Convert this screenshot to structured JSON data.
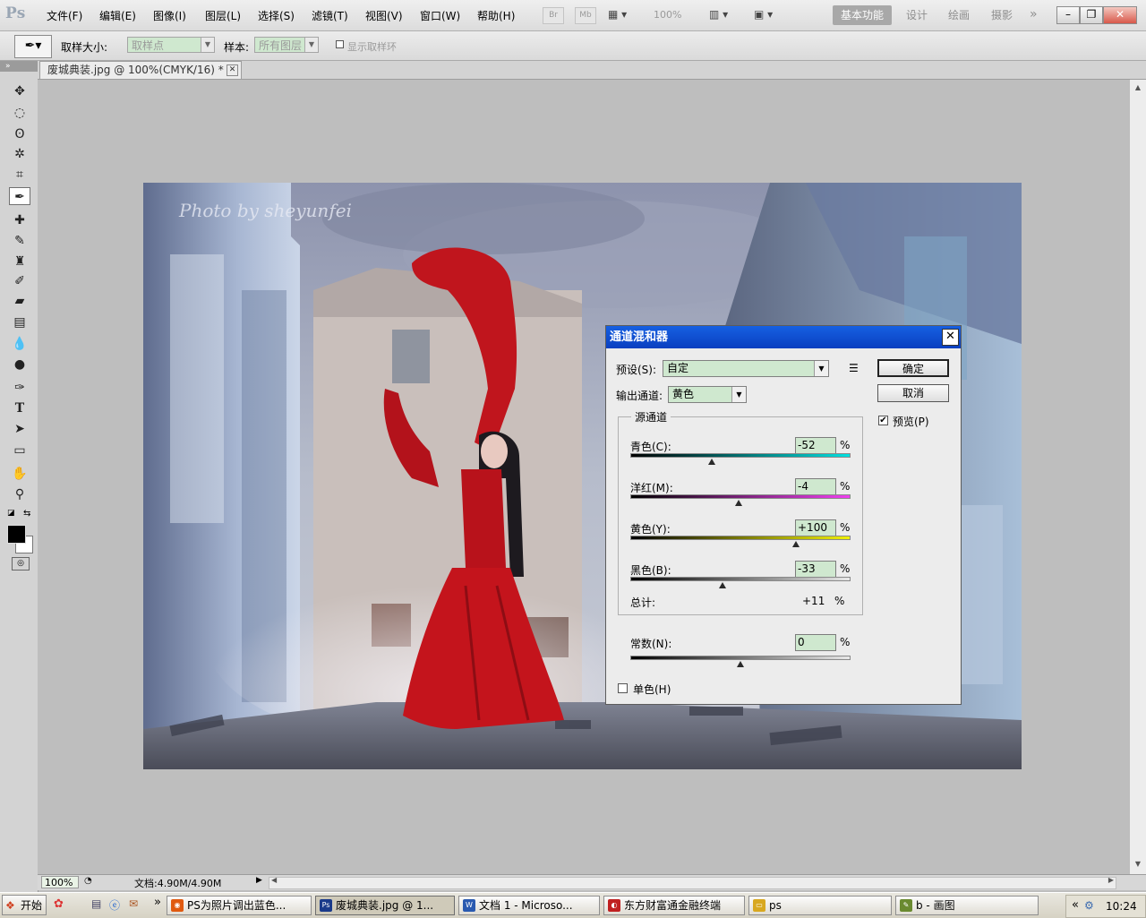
{
  "app": {
    "logo": "Ps"
  },
  "menu": [
    "文件(F)",
    "编辑(E)",
    "图像(I)",
    "图层(L)",
    "选择(S)",
    "滤镜(T)",
    "视图(V)",
    "窗口(W)",
    "帮助(H)"
  ],
  "menu_extras": {
    "bridge": "Br",
    "minibridge": "Mb",
    "zoom": "100%"
  },
  "workspaces": {
    "active": "基本功能",
    "items": [
      "设计",
      "绘画",
      "摄影"
    ]
  },
  "options_bar": {
    "sample_size_label": "取样大小:",
    "sample_size_value": "取样点",
    "sample_label": "样本:",
    "sample_value": "所有图层",
    "show_ring_label": "显示取样环"
  },
  "document": {
    "tab_title": "废城典装.jpg @ 100%(CMYK/16) *"
  },
  "photo": {
    "watermark": "Photo by sheyunfei"
  },
  "status": {
    "zoom": "100%",
    "doc_size": "文档:4.90M/4.90M"
  },
  "dialog": {
    "title": "通道混和器",
    "preset_label": "预设(S):",
    "preset_value": "自定",
    "output_label": "输出通道:",
    "output_value": "黄色",
    "ok_label": "确定",
    "cancel_label": "取消",
    "preview_label": "预览(P)",
    "preview_checked": true,
    "source_group_label": "源通道",
    "sliders": [
      {
        "label": "青色(C):",
        "value": "-52",
        "level": -52,
        "gradient": [
          "#000000",
          "#00e0e0"
        ]
      },
      {
        "label": "洋红(M):",
        "value": "-4",
        "level": -4,
        "gradient": [
          "#000000",
          "#f040f0"
        ]
      },
      {
        "label": "黄色(Y):",
        "value": "+100",
        "level": 100,
        "gradient": [
          "#000000",
          "#f0f000"
        ]
      },
      {
        "label": "黑色(B):",
        "value": "-33",
        "level": -33,
        "gradient": [
          "#000000",
          "#e8e8e8"
        ]
      }
    ],
    "total_label": "总计:",
    "total_value": "+11",
    "total_unit": "%",
    "pct_unit": "%",
    "constant": {
      "label": "常数(N):",
      "value": "0",
      "level": 0
    },
    "mono_label": "单色(H)",
    "mono_checked": false
  },
  "taskbar": {
    "start_label": "开始",
    "tasks": [
      {
        "label": "PS为照片调出蓝色...",
        "icon": "firefox-icon",
        "active": false
      },
      {
        "label": "废城典装.jpg @ 1...",
        "icon": "photoshop-icon",
        "active": true
      },
      {
        "label": "文档 1 - Microso...",
        "icon": "word-icon",
        "active": false
      },
      {
        "label": "东方财富通金融终端",
        "icon": "finance-app-icon",
        "active": false
      },
      {
        "label": "ps",
        "icon": "folder-icon",
        "active": false
      },
      {
        "label": "b - 画图",
        "icon": "paint-icon",
        "active": false
      }
    ],
    "clock": "10:24"
  },
  "colors": {
    "accent": "#0a3fc0",
    "field_bg": "#cfe8cf",
    "workspace_active": "#a8a8a8"
  }
}
